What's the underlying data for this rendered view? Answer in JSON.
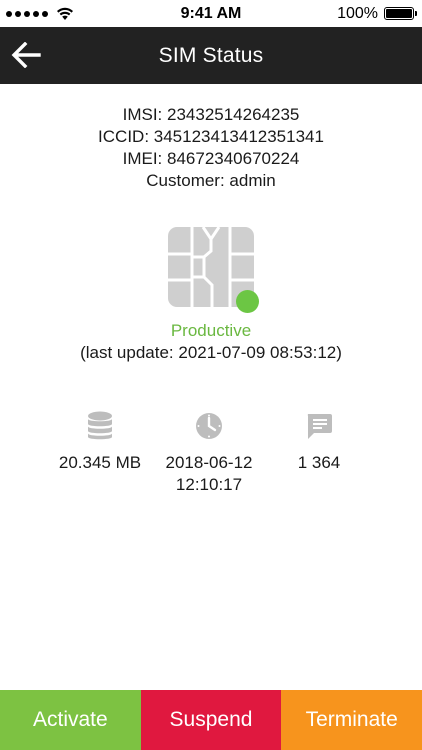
{
  "status_bar": {
    "time": "9:41 AM",
    "battery": "100%",
    "battery_level": 1.0
  },
  "nav": {
    "title": "SIM Status",
    "back_icon": "arrow-left-icon"
  },
  "sim": {
    "imsi_line": "IMSI: 23432514264235",
    "iccid_line": "ICCID: 345123413412351341",
    "imei_line": "IMEI: 84672340670224",
    "customer_line": "Customer: admin"
  },
  "state": {
    "status": "Productive",
    "status_color": "#6cc644",
    "last_update": "(last update: 2021-07-09 08:53:12)"
  },
  "stats": {
    "data_usage": {
      "icon": "database-icon",
      "value": "20.345 MB"
    },
    "last_session": {
      "icon": "clock-icon",
      "date": "2018-06-12",
      "time": "12:10:17"
    },
    "sms_count": {
      "icon": "message-icon",
      "value": "1 364"
    }
  },
  "actions": {
    "activate": {
      "label": "Activate",
      "color": "#7dc242"
    },
    "suspend": {
      "label": "Suspend",
      "color": "#e0183f"
    },
    "terminate": {
      "label": "Terminate",
      "color": "#f7941d"
    }
  }
}
